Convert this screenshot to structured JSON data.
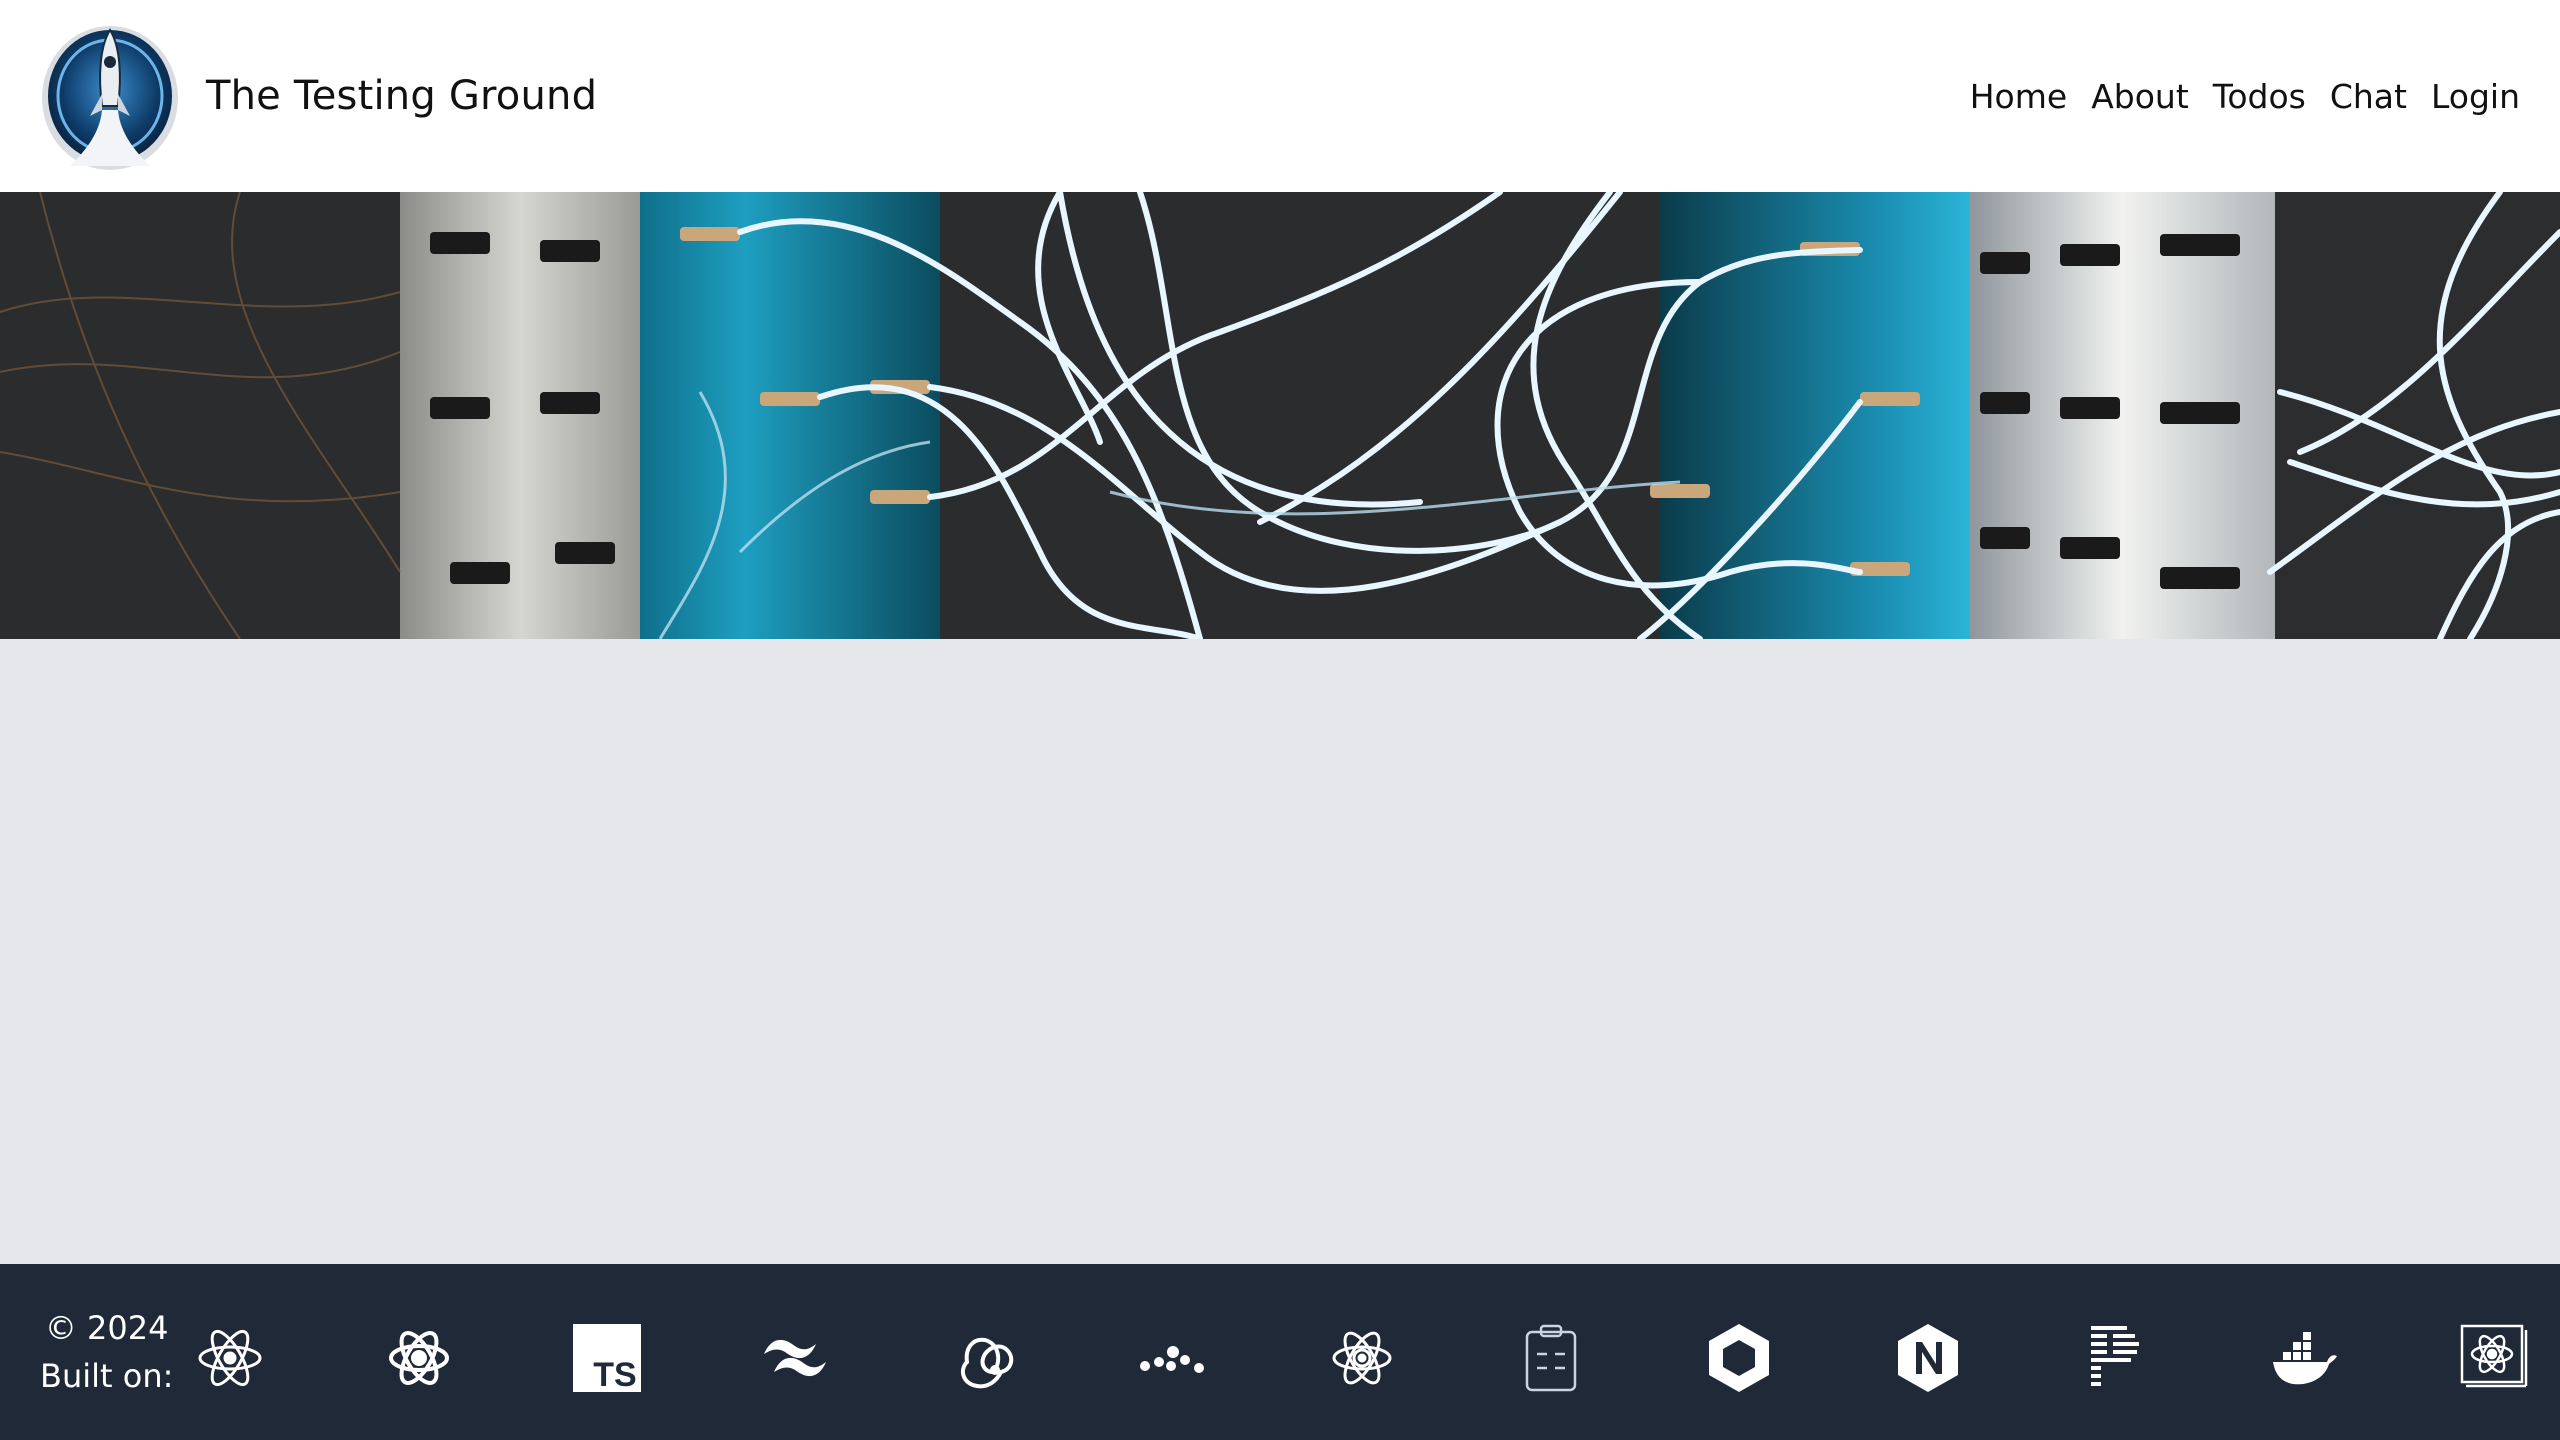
{
  "header": {
    "title": "The Testing Ground",
    "logo_icon": "rocket-logo-icon",
    "nav": [
      {
        "label": "Home"
      },
      {
        "label": "About"
      },
      {
        "label": "Todos"
      },
      {
        "label": "Chat"
      },
      {
        "label": "Login"
      }
    ]
  },
  "hero": {
    "image": "patch-panel-glowing-cables-banner"
  },
  "footer": {
    "copyright": "© 2024",
    "built_on": "Built on:",
    "stack_icons": [
      "react-icon",
      "react-native-icon",
      "typescript-icon",
      "tailwind-icon",
      "redux-icon",
      "dot-cluster-icon",
      "react-atom-icon",
      "clipboard-icon",
      "hexagon-icon",
      "nginx-icon",
      "prisma-icon",
      "docker-icon",
      "react-testing-icon"
    ]
  },
  "colors": {
    "header_bg": "#ffffff",
    "main_bg": "#e5e7eb",
    "footer_bg": "#1f2937",
    "text_dark": "#111111",
    "footer_text": "#ffffff"
  }
}
